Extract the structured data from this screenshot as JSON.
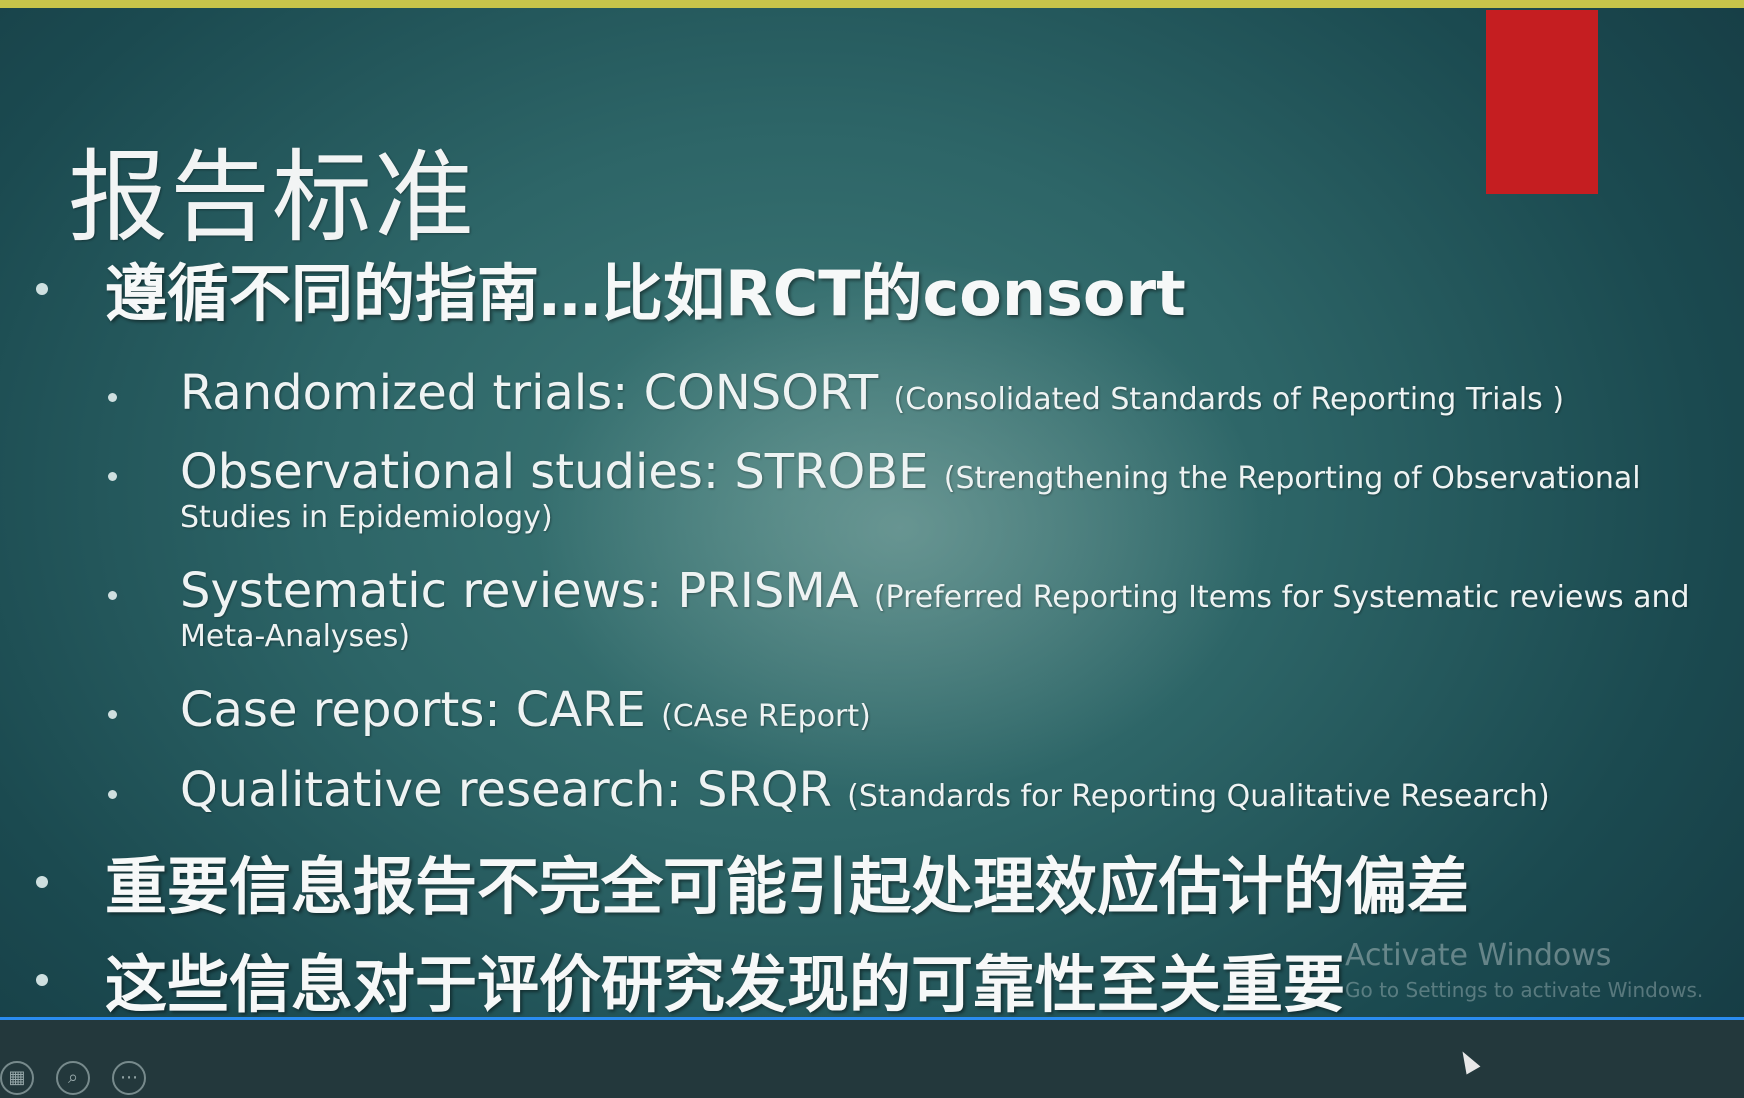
{
  "slide": {
    "title": "报告标准",
    "bullets_top": "遵循不同的指南…比如RCT的consort",
    "items": [
      {
        "main": "Randomized trials: CONSORT ",
        "detail": "(Consolidated Standards of Reporting Trials )",
        "cont": ""
      },
      {
        "main": "Observational studies: STROBE ",
        "detail": "(Strengthening the Reporting of Observational",
        "cont": "Studies in Epidemiology)"
      },
      {
        "main": "Systematic reviews: PRISMA ",
        "detail": "(Preferred Reporting Items for Systematic reviews and",
        "cont": "Meta-Analyses)"
      },
      {
        "main": "Case reports: CARE ",
        "detail": "(CAse REport)",
        "cont": ""
      },
      {
        "main": "Qualitative research:  SRQR ",
        "detail": "(Standards for Reporting Qualitative Research)",
        "cont": ""
      }
    ],
    "bullet_bottom_1": "重要信息报告不完全可能引起处理效应估计的偏差",
    "bullet_bottom_2": "这些信息对于评价研究发现的可靠性至关重要"
  },
  "watermark": {
    "line1": "Activate Windows",
    "line2": "Go to Settings to activate Windows."
  },
  "controls": [
    "slides-icon",
    "zoom-icon",
    "more-icon"
  ],
  "colors": {
    "accent_red": "#c51e21",
    "progress_blue": "#2a8cf0",
    "top_strip": "#c7c44a"
  }
}
